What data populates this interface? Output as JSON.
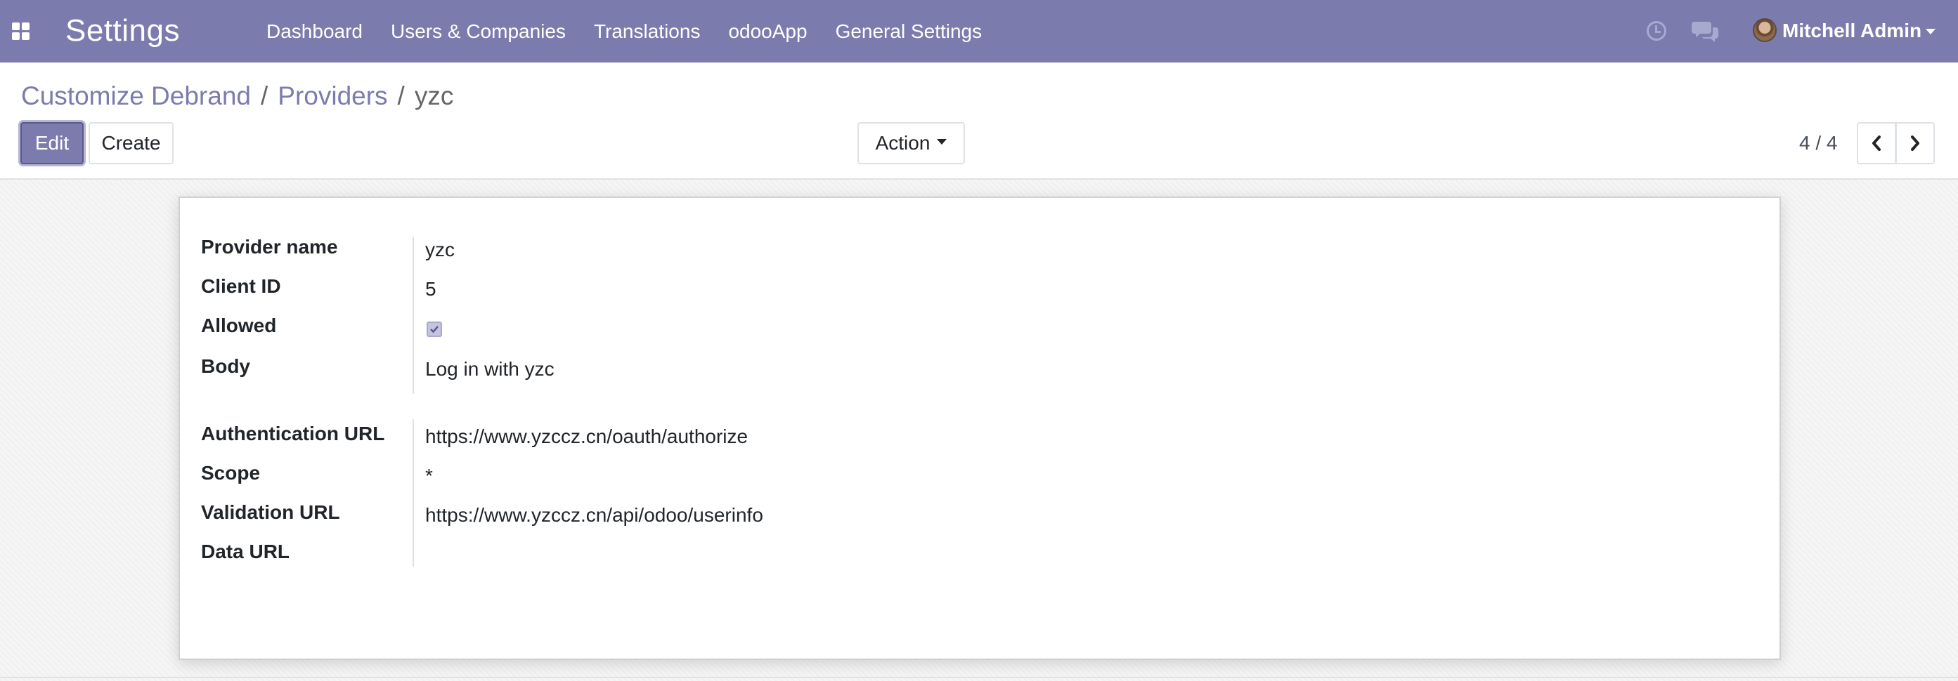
{
  "navbar": {
    "app_title": "Settings",
    "menu": [
      "Dashboard",
      "Users & Companies",
      "Translations",
      "odooApp",
      "General Settings"
    ],
    "user_name": "Mitchell Admin",
    "icons": [
      "apps-grid-icon",
      "clock-icon",
      "chat-bubbles-icon",
      "avatar",
      "caret-down-icon"
    ],
    "background_color": "#7c7bad"
  },
  "breadcrumb": {
    "items": [
      "Customize Debrand",
      "Providers",
      "yzc"
    ],
    "separator": "/"
  },
  "buttons": {
    "edit": "Edit",
    "create": "Create",
    "action": "Action"
  },
  "pager": {
    "value": "4 / 4"
  },
  "form": {
    "group1": [
      {
        "label": "Provider name",
        "value": "yzc"
      },
      {
        "label": "Client ID",
        "value": "5"
      },
      {
        "label": "Allowed",
        "value": true
      },
      {
        "label": "Body",
        "value": "Log in with yzc"
      }
    ],
    "group2": [
      {
        "label": "Authentication URL",
        "value": "https://www.yzccz.cn/oauth/authorize"
      },
      {
        "label": "Scope",
        "value": "*"
      },
      {
        "label": "Validation URL",
        "value": "https://www.yzccz.cn/api/odoo/userinfo"
      },
      {
        "label": "Data URL",
        "value": ""
      }
    ]
  },
  "colors": {
    "accent": "#7c7bad",
    "checkbox_fill": "#c5c4de"
  }
}
